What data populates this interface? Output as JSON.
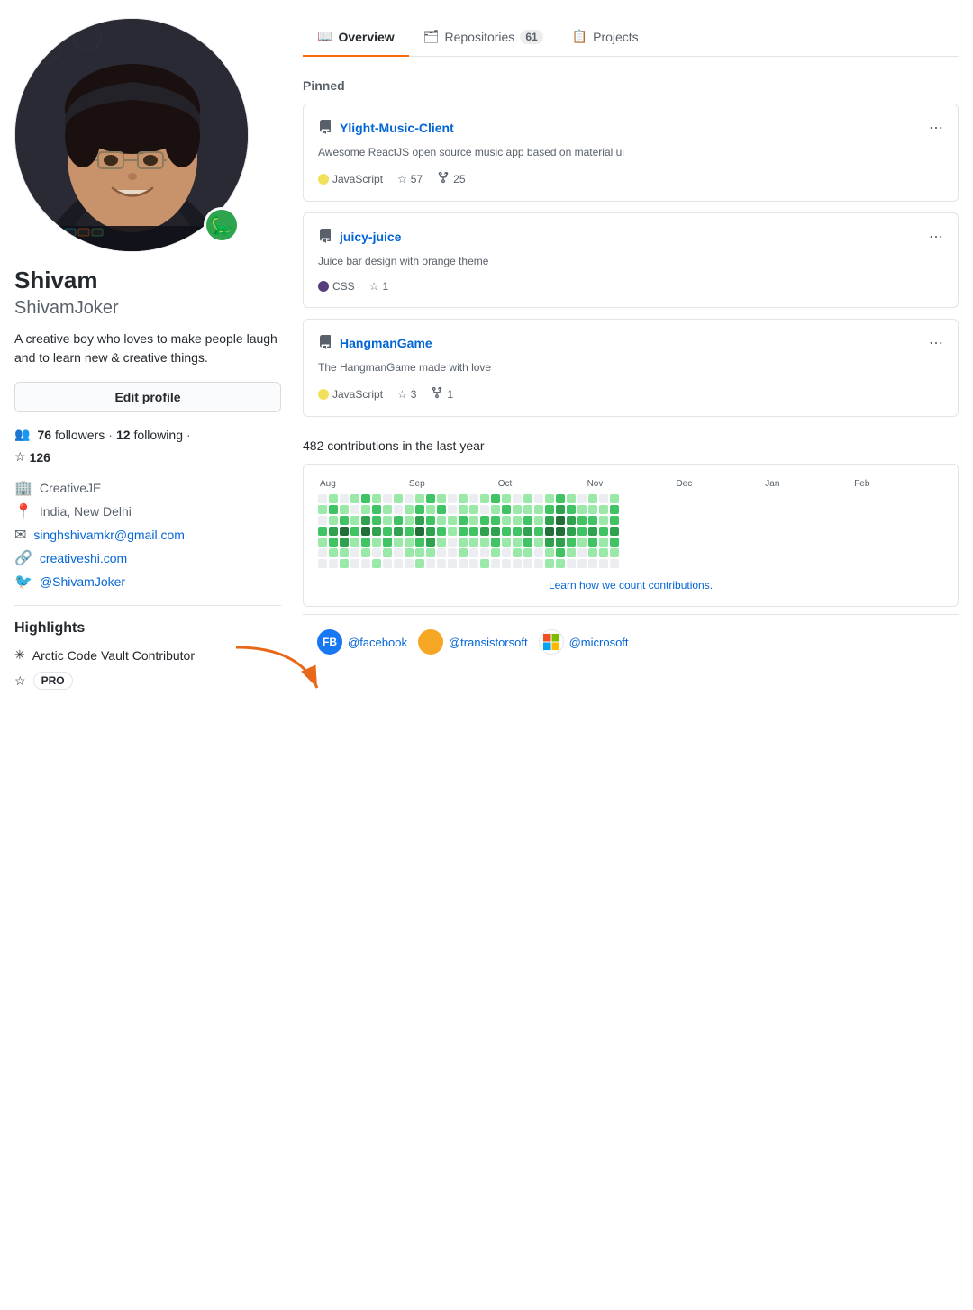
{
  "user": {
    "display_name": "Shivam",
    "login": "ShivamJoker",
    "bio": "A creative boy who loves to make people laugh and to learn new & creative things.",
    "followers": "76",
    "following": "12",
    "stars": "126",
    "company": "CreativeJE",
    "location": "India, New Delhi",
    "email": "singhshivamkr@gmail.com",
    "website": "creativeshi.com",
    "twitter": "@ShivamJoker"
  },
  "tabs": [
    {
      "label": "Overview",
      "icon": "📖",
      "active": true
    },
    {
      "label": "Repositories",
      "count": "61",
      "icon": "🗂"
    },
    {
      "label": "Projects",
      "icon": "📋"
    }
  ],
  "pinned_label": "Pinned",
  "repos": [
    {
      "name": "Ylight-Music-Client",
      "desc": "Awesome ReactJS open source music app based on material ui",
      "lang": "JavaScript",
      "lang_color": "#f1e05a",
      "stars": "57",
      "forks": "25"
    },
    {
      "name": "juicy-juice",
      "desc": "Juice bar design with orange theme",
      "lang": "CSS",
      "lang_color": "#563d7c",
      "stars": "1",
      "forks": null
    },
    {
      "name": "HangmanGame",
      "desc": "The HangmanGame made with love",
      "lang": "JavaScript",
      "lang_color": "#f1e05a",
      "stars": "3",
      "forks": "1"
    }
  ],
  "contributions": {
    "title": "482 contributions in the last year",
    "months": [
      "Aug",
      "Sep",
      "Oct",
      "Nov",
      "Dec",
      "Jan",
      "Feb"
    ],
    "footer_link": "Learn how we count contributions.",
    "learn_link": "#"
  },
  "highlights": {
    "title": "Highlights",
    "items": [
      {
        "label": "Arctic Code Vault Contributor",
        "icon": "✳"
      },
      {
        "label": "PRO",
        "is_badge": true,
        "icon": "⭐"
      }
    ]
  },
  "social_orgs": [
    {
      "name": "@facebook",
      "type": "fb"
    },
    {
      "name": "@transistorsoft",
      "type": "transistor"
    },
    {
      "name": "@microsoft",
      "type": "ms"
    }
  ],
  "edit_profile_label": "Edit profile",
  "followers_label": "followers",
  "following_label": "following"
}
